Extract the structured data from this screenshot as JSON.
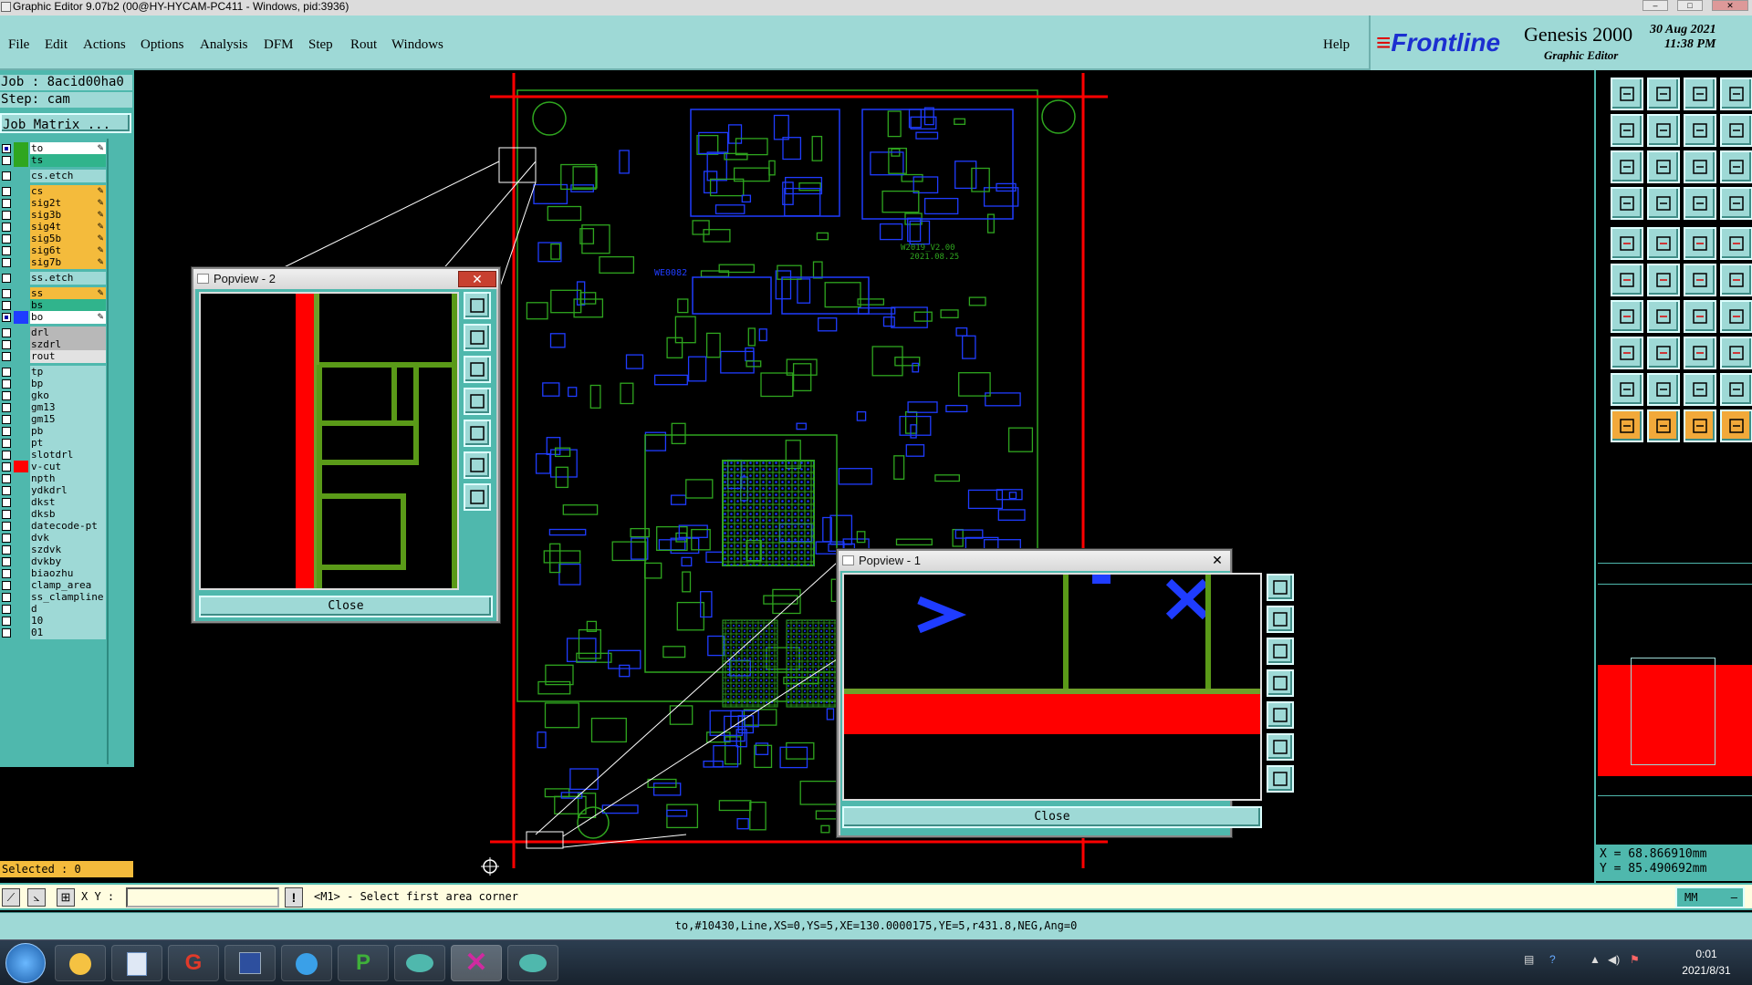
{
  "window": {
    "title": "Graphic Editor 9.07b2 (00@HY-HYCAM-PC411 - Windows, pid:3936)"
  },
  "menu": [
    "File",
    "Edit",
    "Actions",
    "Options",
    "Analysis",
    "DFM",
    "Step",
    "Rout",
    "Windows"
  ],
  "help": "Help",
  "branding": {
    "logo": "Frontline",
    "product": "Genesis 2000",
    "subtitle": "Graphic Editor",
    "date": "30 Aug 2021",
    "time": "11:38 PM"
  },
  "job": {
    "job_label": "Job : 8acid00ha0",
    "step_label": "Step: cam",
    "matrix_button": "Job Matrix ..."
  },
  "layers": [
    {
      "name": "to",
      "color": "#2fa61f",
      "bg": "#ffffff",
      "checked": true,
      "edit": true
    },
    {
      "name": "ts",
      "color": "#2fa61f",
      "bg": "#30b48c",
      "checked": false,
      "edit": false
    },
    {
      "name": "cs.etch",
      "color": "",
      "bg": "#9ed9d6",
      "checked": false,
      "edit": false
    },
    {
      "name": "cs",
      "color": "",
      "bg": "#f4bb3c",
      "checked": false,
      "edit": true
    },
    {
      "name": "sig2t",
      "color": "",
      "bg": "#f4bb3c",
      "checked": false,
      "edit": true
    },
    {
      "name": "sig3b",
      "color": "",
      "bg": "#f4bb3c",
      "checked": false,
      "edit": true
    },
    {
      "name": "sig4t",
      "color": "",
      "bg": "#f4bb3c",
      "checked": false,
      "edit": true
    },
    {
      "name": "sig5b",
      "color": "",
      "bg": "#f4bb3c",
      "checked": false,
      "edit": true
    },
    {
      "name": "sig6t",
      "color": "",
      "bg": "#f4bb3c",
      "checked": false,
      "edit": true
    },
    {
      "name": "sig7b",
      "color": "",
      "bg": "#f4bb3c",
      "checked": false,
      "edit": true
    },
    {
      "name": "ss.etch",
      "color": "",
      "bg": "#9ed9d6",
      "checked": false,
      "edit": false
    },
    {
      "name": "ss",
      "color": "",
      "bg": "#f4bb3c",
      "checked": false,
      "edit": true
    },
    {
      "name": "bs",
      "color": "",
      "bg": "#30b48c",
      "checked": false,
      "edit": false
    },
    {
      "name": "bo",
      "color": "#1f3cff",
      "bg": "#ffffff",
      "checked": true,
      "edit": true
    },
    {
      "name": "drl",
      "color": "",
      "bg": "#b8b8b8",
      "checked": false,
      "edit": false
    },
    {
      "name": "szdrl",
      "color": "",
      "bg": "#b8b8b8",
      "checked": false,
      "edit": false
    },
    {
      "name": "rout",
      "color": "",
      "bg": "#e2e2e2",
      "checked": false,
      "edit": false
    },
    {
      "name": "tp",
      "color": "",
      "bg": "#9ed9d6",
      "checked": false,
      "edit": false
    },
    {
      "name": "bp",
      "color": "",
      "bg": "#9ed9d6",
      "checked": false,
      "edit": false
    },
    {
      "name": "gko",
      "color": "",
      "bg": "#9ed9d6",
      "checked": false,
      "edit": false
    },
    {
      "name": "gm13",
      "color": "",
      "bg": "#9ed9d6",
      "checked": false,
      "edit": false
    },
    {
      "name": "gm15",
      "color": "",
      "bg": "#9ed9d6",
      "checked": false,
      "edit": false
    },
    {
      "name": "pb",
      "color": "",
      "bg": "#9ed9d6",
      "checked": false,
      "edit": false
    },
    {
      "name": "pt",
      "color": "",
      "bg": "#9ed9d6",
      "checked": false,
      "edit": false
    },
    {
      "name": "slotdrl",
      "color": "",
      "bg": "#9ed9d6",
      "checked": false,
      "edit": false
    },
    {
      "name": "v-cut",
      "color": "#ff0000",
      "bg": "#9ed9d6",
      "checked": false,
      "edit": false
    },
    {
      "name": "npth",
      "color": "",
      "bg": "#9ed9d6",
      "checked": false,
      "edit": false
    },
    {
      "name": "ydkdrl",
      "color": "",
      "bg": "#9ed9d6",
      "checked": false,
      "edit": false
    },
    {
      "name": "dkst",
      "color": "",
      "bg": "#9ed9d6",
      "checked": false,
      "edit": false
    },
    {
      "name": "dksb",
      "color": "",
      "bg": "#9ed9d6",
      "checked": false,
      "edit": false
    },
    {
      "name": "datecode-pt",
      "color": "",
      "bg": "#9ed9d6",
      "checked": false,
      "edit": false
    },
    {
      "name": "dvk",
      "color": "",
      "bg": "#9ed9d6",
      "checked": false,
      "edit": false
    },
    {
      "name": "szdvk",
      "color": "",
      "bg": "#9ed9d6",
      "checked": false,
      "edit": false
    },
    {
      "name": "dvkby",
      "color": "",
      "bg": "#9ed9d6",
      "checked": false,
      "edit": false
    },
    {
      "name": "biaozhu",
      "color": "",
      "bg": "#9ed9d6",
      "checked": false,
      "edit": false
    },
    {
      "name": "clamp_area",
      "color": "",
      "bg": "#9ed9d6",
      "checked": false,
      "edit": false
    },
    {
      "name": "ss_clampline",
      "color": "",
      "bg": "#9ed9d6",
      "checked": false,
      "edit": false
    },
    {
      "name": "d",
      "color": "",
      "bg": "#9ed9d6",
      "checked": false,
      "edit": false
    },
    {
      "name": "10",
      "color": "",
      "bg": "#9ed9d6",
      "checked": false,
      "edit": false
    },
    {
      "name": "01",
      "color": "",
      "bg": "#9ed9d6",
      "checked": false,
      "edit": false
    }
  ],
  "selected": "Selected : 0",
  "board_text": {
    "ref1": "WE0082",
    "ver": "W2019_V2.00",
    "date": "2021.08.25"
  },
  "popview2": {
    "title": "Popview - 2",
    "close_label": "Close"
  },
  "popview1": {
    "title": "Popview - 1",
    "close_label": "Close"
  },
  "coords": {
    "x": "X = 68.866910mm",
    "y": "Y = 85.490692mm"
  },
  "command": {
    "xy_label": "X Y :",
    "input_value": "",
    "prompt": "<M1> - Select first area corner",
    "units": "MM"
  },
  "status": "to,#10430,Line,XS=0,YS=5,XE=130.0000175,YE=5,r431.8,NEG,Ang=0",
  "clock": {
    "time": "0:01",
    "date": "2021/8/31"
  },
  "colors": {
    "teal": "#4fb8ad",
    "light_teal": "#9ed9d6",
    "orange": "#f4bb3c",
    "red_vcut": "#ff0000",
    "green_to": "#2fa61f",
    "blue_bo": "#1f3cff"
  }
}
